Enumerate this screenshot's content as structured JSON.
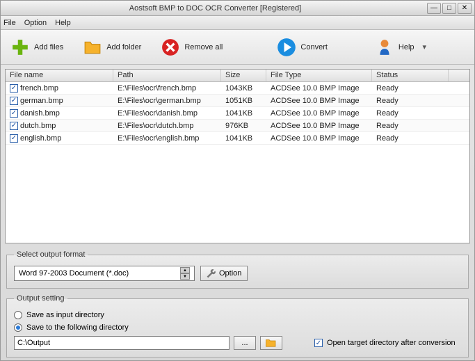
{
  "title": "Aostsoft BMP to DOC OCR Converter [Registered]",
  "menu": {
    "file": "File",
    "option": "Option",
    "help": "Help"
  },
  "toolbar": {
    "add_files": "Add files",
    "add_folder": "Add folder",
    "remove_all": "Remove all",
    "convert": "Convert",
    "help": "Help"
  },
  "table": {
    "headers": {
      "name": "File name",
      "path": "Path",
      "size": "Size",
      "type": "File Type",
      "status": "Status"
    },
    "rows": [
      {
        "checked": true,
        "name": "french.bmp",
        "path": "E:\\Files\\ocr\\french.bmp",
        "size": "1043KB",
        "type": "ACDSee 10.0 BMP Image",
        "status": "Ready"
      },
      {
        "checked": true,
        "name": "german.bmp",
        "path": "E:\\Files\\ocr\\german.bmp",
        "size": "1051KB",
        "type": "ACDSee 10.0 BMP Image",
        "status": "Ready"
      },
      {
        "checked": true,
        "name": "danish.bmp",
        "path": "E:\\Files\\ocr\\danish.bmp",
        "size": "1041KB",
        "type": "ACDSee 10.0 BMP Image",
        "status": "Ready"
      },
      {
        "checked": true,
        "name": "dutch.bmp",
        "path": "E:\\Files\\ocr\\dutch.bmp",
        "size": "976KB",
        "type": "ACDSee 10.0 BMP Image",
        "status": "Ready"
      },
      {
        "checked": true,
        "name": "english.bmp",
        "path": "E:\\Files\\ocr\\english.bmp",
        "size": "1041KB",
        "type": "ACDSee 10.0 BMP Image",
        "status": "Ready"
      }
    ]
  },
  "format": {
    "legend": "Select output format",
    "selected": "Word 97-2003 Document (*.doc)",
    "option_btn": "Option"
  },
  "output": {
    "legend": "Output setting",
    "save_as_input": "Save as input directory",
    "save_following": "Save to the following directory",
    "path": "C:\\Output",
    "open_target": "Open target directory after conversion",
    "selected": "following",
    "open_target_checked": true
  }
}
